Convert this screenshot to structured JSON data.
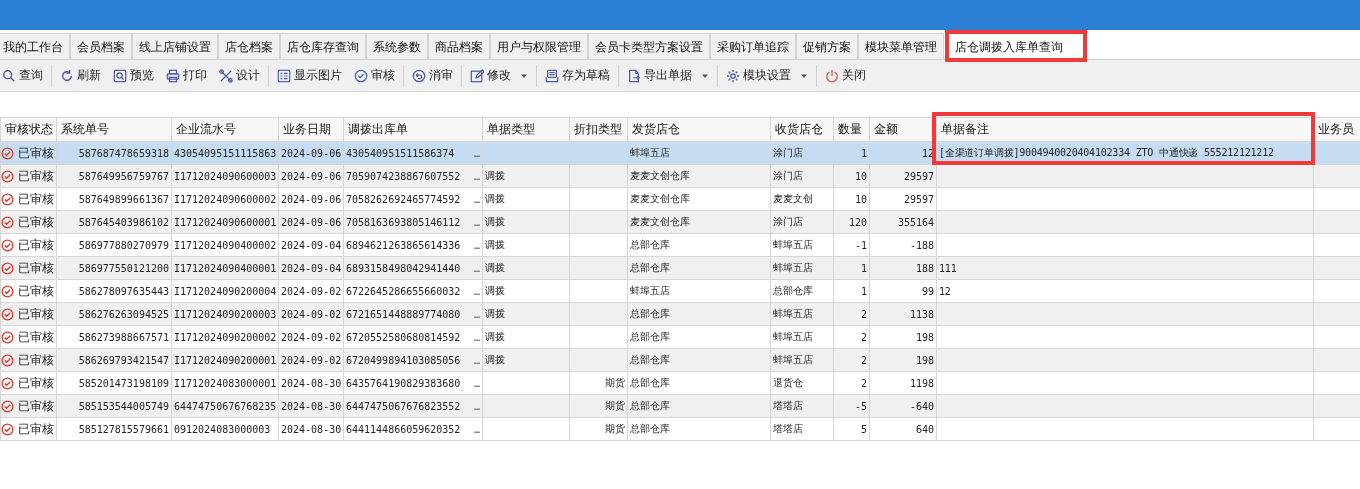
{
  "tabs": [
    {
      "label": "我的工作台",
      "selected": false
    },
    {
      "label": "会员档案",
      "selected": false
    },
    {
      "label": "线上店铺设置",
      "selected": false
    },
    {
      "label": "店仓档案",
      "selected": false
    },
    {
      "label": "店仓库存查询",
      "selected": false
    },
    {
      "label": "系统参数",
      "selected": false
    },
    {
      "label": "商品档案",
      "selected": false
    },
    {
      "label": "用户与权限管理",
      "selected": false
    },
    {
      "label": "会员卡类型方案设置",
      "selected": false
    },
    {
      "label": "采购订单追踪",
      "selected": false
    },
    {
      "label": "促销方案",
      "selected": false
    },
    {
      "label": "模块菜单管理",
      "selected": false
    },
    {
      "label": "店仓调拨入库单查询",
      "selected": true,
      "highlighted": true
    }
  ],
  "toolbar": [
    {
      "label": "查询",
      "dropdown": false
    },
    {
      "label": "刷新",
      "dropdown": false
    },
    {
      "label": "预览",
      "dropdown": false
    },
    {
      "label": "打印",
      "dropdown": false
    },
    {
      "label": "设计",
      "dropdown": false
    },
    {
      "label": "显示图片",
      "dropdown": false
    },
    {
      "label": "审核",
      "dropdown": false
    },
    {
      "label": "消审",
      "dropdown": false
    },
    {
      "label": "修改",
      "dropdown": true
    },
    {
      "label": "存为草稿",
      "dropdown": false
    },
    {
      "label": "导出单据",
      "dropdown": true
    },
    {
      "label": "模块设置",
      "dropdown": true
    },
    {
      "label": "关闭",
      "dropdown": false
    }
  ],
  "table": {
    "columns": [
      {
        "label": "审核状态",
        "highlighted": false
      },
      {
        "label": "系统单号",
        "highlighted": false
      },
      {
        "label": "企业流水号",
        "highlighted": false
      },
      {
        "label": "业务日期",
        "highlighted": false
      },
      {
        "label": "调拨出库单",
        "highlighted": false
      },
      {
        "label": "单据类型",
        "highlighted": false
      },
      {
        "label": "折扣类型",
        "highlighted": false
      },
      {
        "label": "发货店仓",
        "highlighted": false
      },
      {
        "label": "收货店仓",
        "highlighted": false
      },
      {
        "label": "数量",
        "highlighted": false
      },
      {
        "label": "金额",
        "highlighted": false
      },
      {
        "label": "单据备注",
        "highlighted": true
      },
      {
        "label": "业务员",
        "highlighted": false
      }
    ],
    "rows": [
      {
        "selected": true,
        "cells": [
          "已审核",
          "587687478659318",
          "43054095151115863",
          "2024-09-06",
          "430540951511586374",
          "",
          "",
          "蚌埠五店",
          "涂门店",
          "1",
          "12",
          "[全渠道订单调拨]9004940020404102334 ZTO 中通快递 555212121212",
          ""
        ],
        "more": "…"
      },
      {
        "selected": false,
        "cells": [
          "已审核",
          "587649956759767",
          "I1712024090600003",
          "2024-09-06",
          "7059074238867607552",
          "调拨",
          "",
          "麦麦文创仓库",
          "涂门店",
          "10",
          "29597",
          "",
          ""
        ],
        "more": "…"
      },
      {
        "selected": false,
        "cells": [
          "已审核",
          "587649899661367",
          "I1712024090600002",
          "2024-09-06",
          "7058262692465774592",
          "调拨",
          "",
          "麦麦文创仓库",
          "麦麦文创",
          "10",
          "29597",
          "",
          ""
        ],
        "more": "…"
      },
      {
        "selected": false,
        "cells": [
          "已审核",
          "587645403986102",
          "I1712024090600001",
          "2024-09-06",
          "7058163693805146112",
          "调拨",
          "",
          "麦麦文创仓库",
          "涂门店",
          "120",
          "355164",
          "",
          ""
        ],
        "more": "…"
      },
      {
        "selected": false,
        "cells": [
          "已审核",
          "586977880270979",
          "I1712024090400002",
          "2024-09-04",
          "6894621263865614336",
          "调拨",
          "",
          "总部仓库",
          "蚌埠五店",
          "-1",
          "-188",
          "",
          ""
        ],
        "more": "…"
      },
      {
        "selected": false,
        "cells": [
          "已审核",
          "586977550121200",
          "I1712024090400001",
          "2024-09-04",
          "6893158498042941440",
          "调拨",
          "",
          "总部仓库",
          "蚌埠五店",
          "1",
          "188",
          "111",
          ""
        ],
        "more": "…"
      },
      {
        "selected": false,
        "cells": [
          "已审核",
          "586278097635443",
          "I1712024090200004",
          "2024-09-02",
          "6722645286655660032",
          "调拨",
          "",
          "蚌埠五店",
          "总部仓库",
          "1",
          "99",
          "12",
          ""
        ],
        "more": "…"
      },
      {
        "selected": false,
        "cells": [
          "已审核",
          "586276263094525",
          "I1712024090200003",
          "2024-09-02",
          "6721651448889774080",
          "调拨",
          "",
          "总部仓库",
          "蚌埠五店",
          "2",
          "1138",
          "",
          ""
        ],
        "more": "…"
      },
      {
        "selected": false,
        "cells": [
          "已审核",
          "586273988667571",
          "I1712024090200002",
          "2024-09-02",
          "6720552580680814592",
          "调拨",
          "",
          "总部仓库",
          "蚌埠五店",
          "2",
          "198",
          "",
          ""
        ],
        "more": "…"
      },
      {
        "selected": false,
        "cells": [
          "已审核",
          "586269793421547",
          "I1712024090200001",
          "2024-09-02",
          "6720499894103085056",
          "调拨",
          "",
          "总部仓库",
          "蚌埠五店",
          "2",
          "198",
          "",
          ""
        ],
        "more": "…"
      },
      {
        "selected": false,
        "cells": [
          "已审核",
          "585201473198109",
          "I1712024083000001",
          "2024-08-30",
          "6435764190829383680",
          "",
          "期货",
          "总部仓库",
          "退货仓",
          "2",
          "1198",
          "",
          ""
        ],
        "more": "…"
      },
      {
        "selected": false,
        "cells": [
          "已审核",
          "585153544005749",
          "64474750676768235",
          "2024-08-30",
          "6447475067676823552",
          "",
          "期货",
          "总部仓库",
          "塔塔店",
          "-5",
          "-640",
          "",
          ""
        ],
        "more": "…"
      },
      {
        "selected": false,
        "cells": [
          "已审核",
          "585127815579661",
          "0912024083000003",
          "2024-08-30",
          "6441144866059620352",
          "",
          "期货",
          "总部仓库",
          "塔塔店",
          "5",
          "640",
          "",
          ""
        ],
        "more": "…"
      }
    ]
  }
}
